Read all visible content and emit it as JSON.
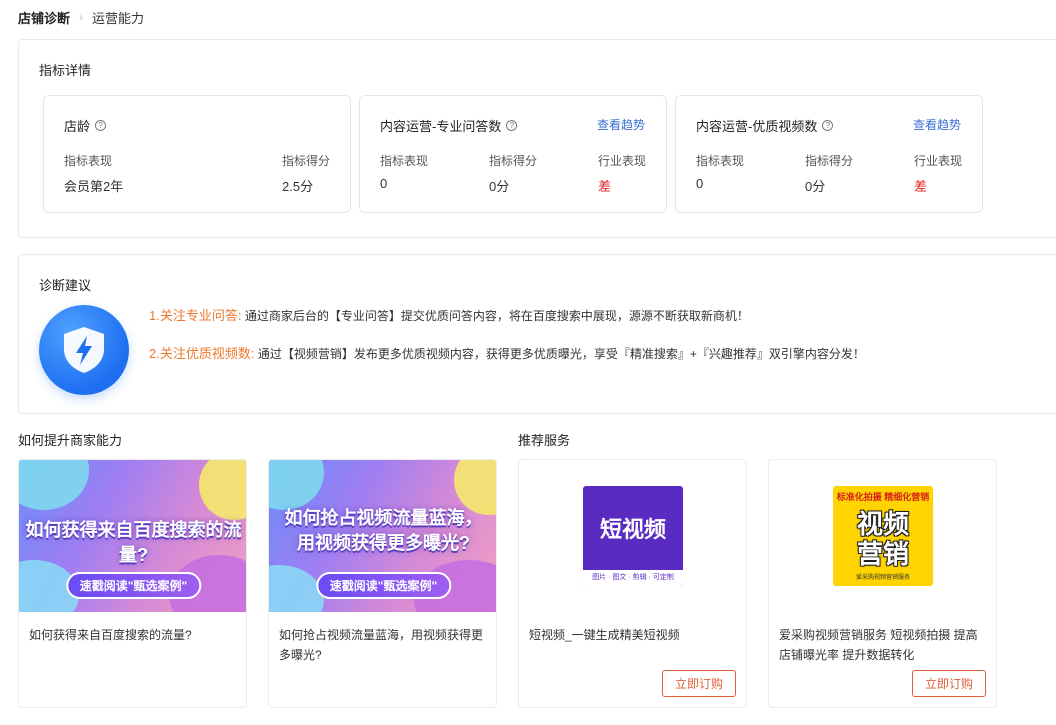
{
  "breadcrumb": {
    "home": "店铺诊断",
    "current": "运营能力"
  },
  "metrics": {
    "title": "指标详情",
    "cards": [
      {
        "name": "店龄",
        "col1_label": "指标表现",
        "col1_value": "会员第2年",
        "col2_label": "指标得分",
        "col2_value": "2.5分"
      },
      {
        "name": "内容运营-专业问答数",
        "link": "查看趋势",
        "col1_label": "指标表现",
        "col1_value": "0",
        "col2_label": "指标得分",
        "col2_value": "0分",
        "col3_label": "行业表现",
        "col3_value": "差"
      },
      {
        "name": "内容运营-优质视频数",
        "link": "查看趋势",
        "col1_label": "指标表现",
        "col1_value": "0",
        "col2_label": "指标得分",
        "col2_value": "0分",
        "col3_label": "行业表现",
        "col3_value": "差"
      }
    ]
  },
  "advice": {
    "title": "诊断建议",
    "items": [
      {
        "head": "1.关注专业问答:",
        "text": "通过商家后台的【专业问答】提交优质问答内容，将在百度搜索中展现，源源不断获取新商机！"
      },
      {
        "head": "2.关注优质视频数:",
        "text": "通过【视频营销】发布更多优质视频内容，获得更多优质曝光，享受『精准搜索』+『兴趣推荐』双引擎内容分发！"
      }
    ]
  },
  "learn": {
    "title": "如何提升商家能力",
    "cards": [
      {
        "banner_headline": "如何获得来自百度搜索的流量?",
        "banner_button": "速戳阅读\"甄选案例\"",
        "text": "如何获得来自百度搜索的流量?"
      },
      {
        "banner_headline_1": "如何抢占视频流量蓝海，",
        "banner_headline_2": "用视频获得更多曝光?",
        "banner_button": "速戳阅读\"甄选案例\"",
        "text": "如何抢占视频流量蓝海，用视频获得更多曝光?"
      }
    ]
  },
  "services": {
    "title": "推荐服务",
    "cards": [
      {
        "image_title": "短视频",
        "image_strip": "图片 · 图文 · 剪辑 · 可定制",
        "text": "短视频_一键生成精美短视频",
        "button": "立即订购"
      },
      {
        "image_top": "标准化拍摄 精细化营销",
        "image_line1": "视频",
        "image_line2": "营销",
        "image_bottom": "爱采购视频营销服务",
        "text": "爱采购视频营销服务 短视频拍摄 提高店铺曝光率 提升数据转化",
        "button": "立即订购"
      }
    ]
  },
  "colors": {
    "accent_link": "#3b6fd4",
    "warning": "#e02020",
    "advice_head": "#f0782d",
    "order_button": "#e0603a",
    "shield": "#1e6ff0"
  },
  "icons": {
    "help": "question-circle-icon",
    "shield": "shield-lightning-icon",
    "breadcrumb_sep": "chevron-right-icon"
  }
}
